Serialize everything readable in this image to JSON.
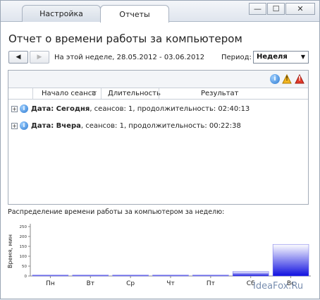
{
  "tabs": {
    "settings": "Настройка",
    "reports": "Отчеты"
  },
  "window_buttons": {
    "minimize": "—",
    "maximize": "☐",
    "close": "✕"
  },
  "page_title": "Отчет о времени работы за компьютером",
  "nav": {
    "prev": "◀",
    "next": "▶",
    "range": "На этой неделе, 28.05.2012 - 03.06.2012"
  },
  "period": {
    "label": "Период:",
    "value": "Неделя",
    "arrow": "▼"
  },
  "toolbar_icons": {
    "info": "i",
    "warning": "!",
    "error": "!"
  },
  "table": {
    "columns": [
      "Начало сеанса",
      "Длительность",
      "Результат"
    ],
    "sort_icon": "▽",
    "rows": [
      {
        "label": "Дата: Сегодня",
        "details": ", сеансов: 1, продолжительность: 02:40:13"
      },
      {
        "label": "Дата: Вчера",
        "details": ", сеансов: 1, продолжительность: 00:22:38"
      }
    ]
  },
  "chart_data": {
    "type": "bar",
    "title": "Распределение времени работы за компьютером за неделю:",
    "ylabel": "Время, мин",
    "ylim": [
      0,
      250
    ],
    "yticks": [
      0,
      50,
      100,
      150,
      200,
      250
    ],
    "categories": [
      "Пн",
      "Вт",
      "Ср",
      "Чт",
      "Пт",
      "Сб",
      "Вс"
    ],
    "values": [
      2,
      2,
      2,
      2,
      2,
      23,
      160
    ]
  },
  "watermark": "IdeaFox.Ru",
  "colors": {
    "bar_top": "#1010e0",
    "bar_bottom": "#ffffff",
    "accent": "#2a78d0"
  }
}
